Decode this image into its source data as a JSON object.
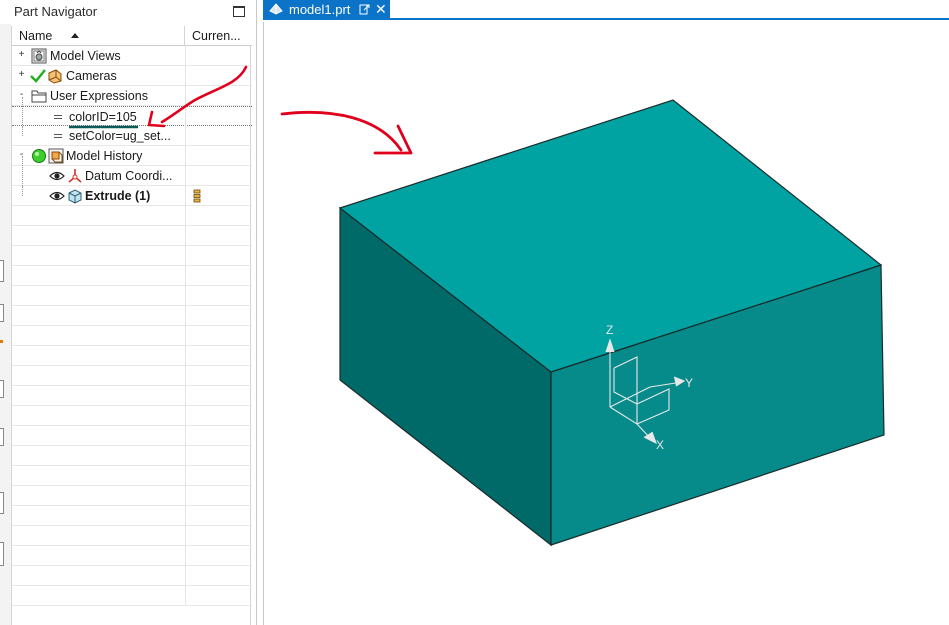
{
  "navigator": {
    "title": "Part Navigator",
    "columns": {
      "name": "Name",
      "current": "Curren..."
    },
    "rows": [
      {
        "label": "Model Views",
        "expander": "+",
        "icon": "model-views-icon"
      },
      {
        "label": "Cameras",
        "expander": "+",
        "icon": "cameras-icon"
      },
      {
        "label": "User Expressions",
        "expander": "-",
        "icon": "folder-icon"
      },
      {
        "label": "colorID=105",
        "icon": "expression-icon"
      },
      {
        "label": "setColor=ug_set...",
        "icon": "expression-icon"
      },
      {
        "label": "Model History",
        "expander": "-",
        "icon": "model-history-icon"
      },
      {
        "label": "Datum Coordi...",
        "icon": "datum-csys-icon"
      },
      {
        "label": "Extrude (1)",
        "icon": "extrude-icon",
        "current_icon": "stack-icon"
      }
    ]
  },
  "tab": {
    "label": "model1.prt",
    "close": "✕"
  },
  "viewport": {
    "axes": {
      "x": "X",
      "y": "Y",
      "z": "Z"
    },
    "colors": {
      "block_top": "#00a3a2",
      "block_left": "#006a69",
      "block_right": "#068a8a",
      "edge": "#1c2a2a",
      "annotation": "#e0001c",
      "underline": "#0a5a5a"
    }
  }
}
